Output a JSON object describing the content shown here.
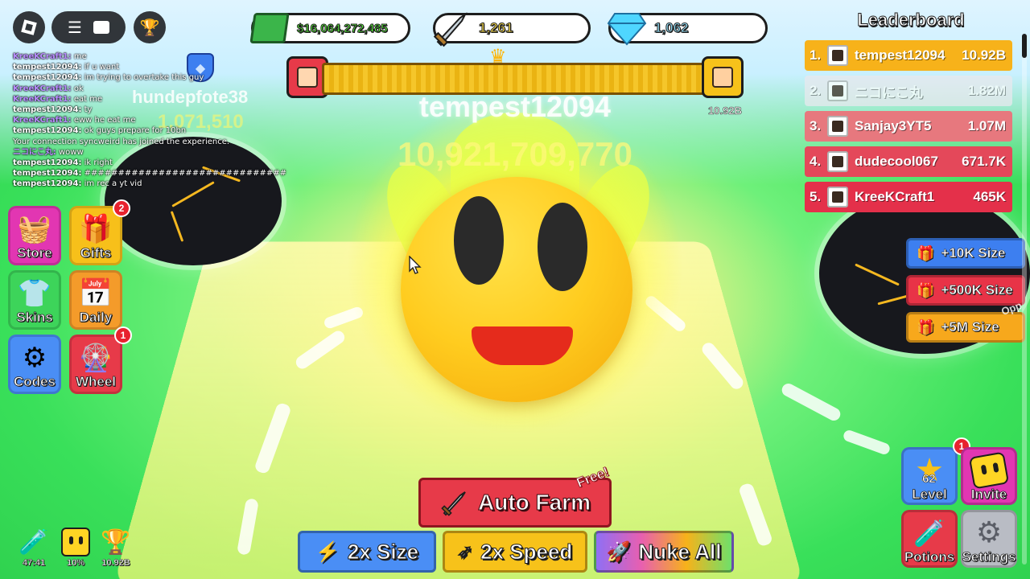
{
  "topbar": {
    "roblox_menu_icon": "roblox-logo-icon",
    "hamburger_icon": "hamburger-icon",
    "chat_icon": "chat-icon",
    "trophy_icon": "trophy-icon"
  },
  "stats": {
    "cash": "$16,064,272,485",
    "swords": "1,261",
    "gems": "1,062"
  },
  "chat": [
    {
      "who": "KreeKCraft1:",
      "msg": "me",
      "color": "#b98cff"
    },
    {
      "who": "tempest12094:",
      "msg": "if u want",
      "color": "#ffffff"
    },
    {
      "who": "tempest12094:",
      "msg": "im trying to overtake this guy",
      "color": "#ffffff"
    },
    {
      "who": "KreeKCraft1:",
      "msg": "ok",
      "color": "#b98cff"
    },
    {
      "who": "KreeKCraft1:",
      "msg": "eat me",
      "color": "#b98cff"
    },
    {
      "who": "tempest12094:",
      "msg": "ty",
      "color": "#ffffff"
    },
    {
      "who": "KreeKCraft1:",
      "msg": "eww he eat me",
      "color": "#b98cff"
    },
    {
      "who": "tempest12094:",
      "msg": "ok guys prepare for 10bn",
      "color": "#ffffff"
    },
    {
      "who": "",
      "msg": "Your connection syncweird has joined the experience.",
      "color": "#ffffff"
    },
    {
      "who": "ニコにこ丸:",
      "msg": "woww",
      "color": "#b98cff"
    },
    {
      "who": "tempest12094:",
      "msg": "ik right",
      "color": "#ffffff"
    },
    {
      "who": "tempest12094:",
      "msg": "##############################",
      "color": "#ffffff"
    },
    {
      "who": "tempest12094:",
      "msg": "im rec a yt vid",
      "color": "#ffffff"
    }
  ],
  "progress": {
    "leader_value": "10.92B",
    "fill": 1.0
  },
  "player": {
    "name": "tempest12094",
    "size": "10,921,709,770"
  },
  "other_player": {
    "name": "hundepfote38",
    "size": "1,071,510"
  },
  "leaderboard": {
    "title": "Leaderboard",
    "rows": [
      {
        "rank": "1.",
        "name": "tempest12094",
        "value": "10.92B",
        "color": "#f7b21a"
      },
      {
        "rank": "2.",
        "name": "ニコにこ丸",
        "value": "1.82M",
        "color": "#e9e9ee"
      },
      {
        "rank": "3.",
        "name": "Sanjay3YT5",
        "value": "1.07M",
        "color": "#e7787e"
      },
      {
        "rank": "4.",
        "name": "dudecool067",
        "value": "671.7K",
        "color": "#e4485a"
      },
      {
        "rank": "5.",
        "name": "KreeKCraft1",
        "value": "465K",
        "color": "#e4304a"
      }
    ]
  },
  "left_menu": {
    "store": "Store",
    "gifts": "Gifts",
    "gifts_badge": "2",
    "skins": "Skins",
    "daily": "Daily",
    "codes": "Codes",
    "wheel": "Wheel",
    "wheel_badge": "1"
  },
  "boosts": [
    {
      "label": "+10K Size",
      "color": "#3d7ff0"
    },
    {
      "label": "+500K Size",
      "color": "#e83347"
    },
    {
      "label": "+5M Size",
      "color": "#f7a81c"
    }
  ],
  "bottom": {
    "auto_farm": "Auto Farm",
    "free": "Free!",
    "size2x": "2x Size",
    "speed2x": "2x Speed",
    "nuke_all": "Nuke All"
  },
  "minis": {
    "potion_timer": "47:41",
    "face_pct": "10%",
    "trophy_val": "10.92B"
  },
  "bottom_right": {
    "level_num": "62",
    "level": "Level",
    "level_badge": "1",
    "invite": "Invite",
    "potions": "Potions",
    "settings": "Settings"
  },
  "colors": {
    "accent_red": "#e73a49",
    "accent_blue": "#3d7ff0",
    "accent_gold": "#f7b21a"
  }
}
